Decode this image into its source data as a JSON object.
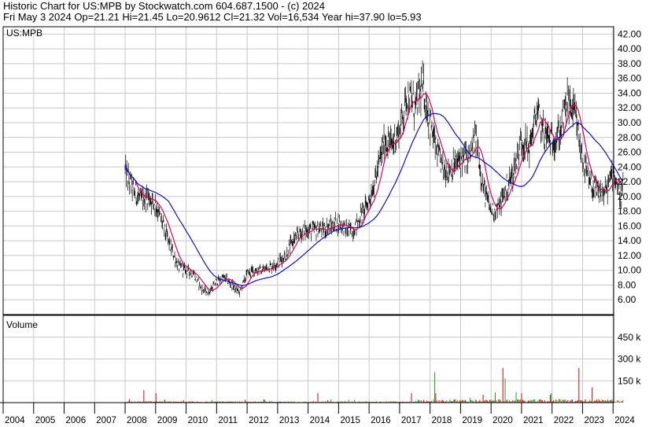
{
  "header": {
    "line1": "Historic Chart for US:MPB by Stockwatch.com 604.687.1500 - (c) 2024",
    "line2": "Fri May  3 2024   Op=21.21  Hi=21.45  Lo=20.9612  Cl=21.32  Vol=16,534  Year hi=37.90  lo=5.93"
  },
  "colors": {
    "grid": "#c8c8c8",
    "price": "#000000",
    "ma_short": "#e0005a",
    "ma_long": "#1010c8",
    "vol_red": "#e00000",
    "vol_green": "#20a020",
    "frame": "#000000"
  },
  "chart_data": [
    {
      "type": "line",
      "title": "US:MPB",
      "ylim": [
        4.0,
        43.0
      ],
      "yticks": [
        "6.00",
        "8.00",
        "10.00",
        "12.00",
        "14.00",
        "16.00",
        "18.00",
        "20.00",
        "22.00",
        "24.00",
        "26.00",
        "28.00",
        "30.00",
        "32.00",
        "34.00",
        "36.00",
        "38.00",
        "40.00",
        "42.00"
      ],
      "x": [
        2008.0,
        2008.25,
        2008.5,
        2008.75,
        2009.0,
        2009.25,
        2009.5,
        2009.75,
        2010.0,
        2010.25,
        2010.5,
        2010.75,
        2011.0,
        2011.25,
        2011.5,
        2011.75,
        2012.0,
        2012.25,
        2012.5,
        2012.75,
        2013.0,
        2013.25,
        2013.5,
        2013.75,
        2014.0,
        2014.25,
        2014.5,
        2014.75,
        2015.0,
        2015.25,
        2015.5,
        2015.75,
        2016.0,
        2016.25,
        2016.5,
        2016.75,
        2017.0,
        2017.25,
        2017.5,
        2017.75,
        2018.0,
        2018.25,
        2018.5,
        2018.75,
        2019.0,
        2019.25,
        2019.5,
        2019.75,
        2020.0,
        2020.25,
        2020.5,
        2020.75,
        2021.0,
        2021.25,
        2021.5,
        2021.75,
        2022.0,
        2022.25,
        2022.5,
        2022.75,
        2023.0,
        2023.25,
        2023.5,
        2023.75,
        2024.0,
        2024.25,
        2024.34
      ],
      "series": [
        {
          "name": "",
          "values": [
            23.5,
            21.0,
            19.5,
            20.0,
            19.0,
            16.0,
            13.0,
            10.5,
            10.0,
            9.5,
            7.5,
            7.0,
            8.5,
            9.0,
            8.0,
            7.0,
            9.5,
            10.0,
            10.0,
            10.5,
            11.0,
            12.0,
            14.0,
            15.0,
            15.5,
            15.5,
            15.5,
            16.0,
            16.5,
            15.5,
            15.5,
            17.5,
            19.5,
            23.0,
            27.5,
            27.0,
            29.0,
            34.0,
            32.0,
            35.0,
            30.0,
            25.5,
            23.5,
            24.0,
            25.0,
            25.0,
            28.0,
            21.0,
            18.0,
            18.5,
            21.0,
            23.5,
            27.5,
            26.5,
            31.5,
            28.5,
            27.5,
            28.5,
            33.0,
            31.0,
            25.0,
            21.5,
            20.5,
            20.5,
            23.5,
            20.0,
            21.3
          ]
        }
      ]
    },
    {
      "type": "bar",
      "title": "Volume",
      "yticks": [
        "150 k",
        "300 k",
        "450 k"
      ],
      "ylim": [
        0,
        600
      ]
    }
  ],
  "x_axis": {
    "years": [
      "2004",
      "2005",
      "2006",
      "2007",
      "2008",
      "2009",
      "2010",
      "2011",
      "2012",
      "2013",
      "2014",
      "2015",
      "2016",
      "2017",
      "2018",
      "2019",
      "2020",
      "2021",
      "2022",
      "2023",
      "2024"
    ]
  }
}
